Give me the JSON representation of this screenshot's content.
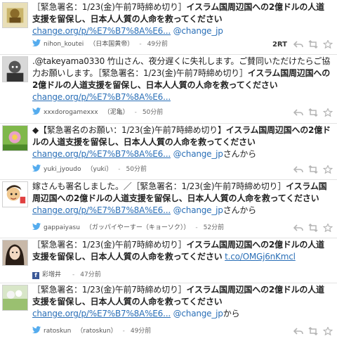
{
  "tweets": [
    {
      "text_pre": "［緊急署名：1/23(金)午前7時締め切り］",
      "text_bold": "イスラム国周辺国への2億ドルの人道支援を留保し、日本人人質の人命を救ってください",
      "link": "change.org/p/%E7%B7%8A%E6...",
      "text_post": "",
      "mention": "@change_jp",
      "mention_suffix": "",
      "handle": "nihon_koutei",
      "name": "（日本国黄帝）",
      "time": "49分前",
      "rt_count": "2RT"
    },
    {
      "text_pre": ".@takeyama0330 竹山さん、夜分遅くに失礼します。ご賛同いただけたらご協力お願いします。［緊急署名：1/23(金)午前7時締め切り］",
      "text_bold": "イスラム国周辺国への2億ドルの人道支援を留保し、日本人人質の人命を救ってください",
      "link": "change.org/p/%E7%B7%8A%E6...",
      "text_post": "",
      "mention": "",
      "mention_suffix": "",
      "handle": "xxxdorogamexxx",
      "name": "（泥亀）",
      "time": "50分前",
      "rt_count": ""
    },
    {
      "text_pre": "◆【緊急署名のお願い：1/23(金)午前7時締め切り】",
      "text_bold": "イスラム国周辺国への2億ドルの人道支援を留保し、日本人人質の人命を救ってください",
      "link": "change.org/p/%E7%B7%8A%E6...",
      "text_post": "",
      "mention": "@change_jp",
      "mention_suffix": "さんから",
      "handle": "yuki_jyoudo",
      "name": "（yuki）",
      "time": "50分前",
      "rt_count": ""
    },
    {
      "text_pre": "嫁さんも署名しました。／［緊急署名：1/23(金)午前7時締め切り］",
      "text_bold": "イスラム国周辺国への2億ドルの人道支援を留保し、日本人人質の人命を救ってください",
      "link": "change.org/p/%E7%B7%8A%E6...",
      "text_post": "",
      "mention": "@change_jp",
      "mention_suffix": "さんから",
      "handle": "gappaiyasu",
      "name": "（ガッパイやーすー（キョーソク））",
      "time": "52分前",
      "rt_count": ""
    },
    {
      "text_pre": "［緊急署名：1/23(金)午前7時締め切り］",
      "text_bold": "イスラム国周辺国への2億ドルの人道支援を留保し、日本人人質の人命を救ってください",
      "link": "t.co/OMGj6nKmcl",
      "text_post": "",
      "mention": "",
      "mention_suffix": "",
      "handle": "彩増井",
      "name": "",
      "time": "47分前",
      "rt_count": ""
    },
    {
      "text_pre": "［緊急署名：1/23(金)午前7時締め切り］",
      "text_bold": "イスラム国周辺国への2億ドルの人道支援を留保し、日本人人質の人命を救ってください",
      "link": "change.org/p/%E7%B7%8A%E6...",
      "text_post": "",
      "mention": "@change_jp",
      "mention_suffix": "から",
      "handle": "ratoskun",
      "name": "（ratoskun）",
      "time": "49分前",
      "rt_count": ""
    }
  ],
  "icons": {
    "twitter": "twitter-bird-icon",
    "facebook": "facebook-icon",
    "reply": "reply-icon",
    "retweet": "retweet-icon",
    "favorite": "star-icon"
  },
  "colors": {
    "link": "#2a6fb7",
    "twitter": "#55acee",
    "facebook": "#3b5998"
  }
}
